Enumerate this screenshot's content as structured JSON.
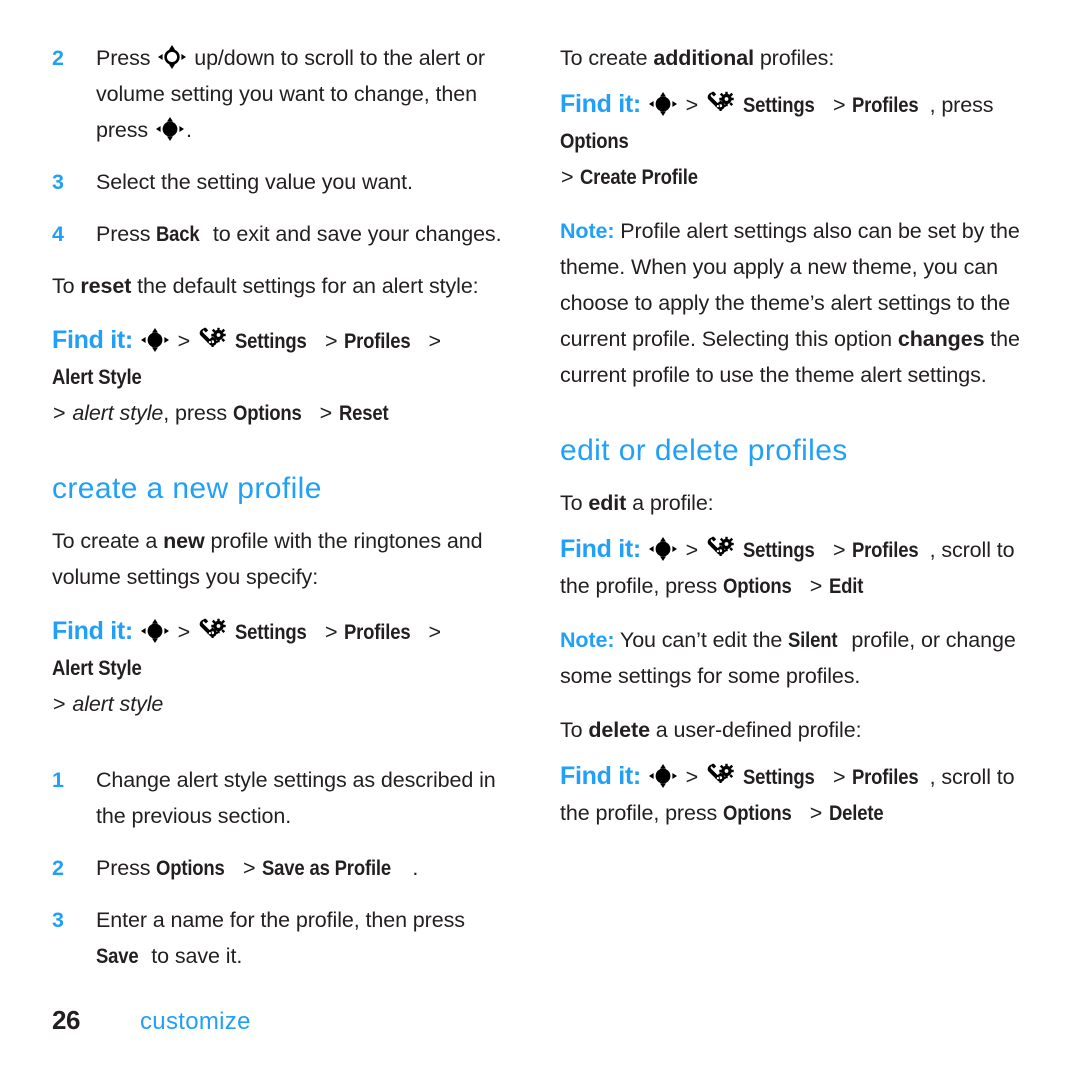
{
  "document": {
    "page_number": "26",
    "chapter": "customize",
    "accent_color": "#22a0f8",
    "text_color": "#231f20"
  },
  "icons": {
    "nav_scroll": "nav-key-hollow-icon",
    "nav_press": "nav-key-filled-icon",
    "settings": "settings-wrench-gear-icon"
  },
  "left_column": {
    "steps_top": [
      {
        "num": "2",
        "pre": "Press ",
        "mid": " up/down to scroll to the alert or volume setting you want to change, then press ",
        "post": "."
      },
      {
        "num": "3",
        "text": "Select the setting value you want."
      },
      {
        "num": "4",
        "pre": "Press ",
        "key": "Back",
        "post": " to exit and save your changes."
      }
    ],
    "reset_intro": {
      "pre": "To ",
      "bold": "reset",
      "post": " the default settings for an alert style:"
    },
    "reset_findit": {
      "label": "Find it:",
      "items": [
        "Settings",
        "Profiles",
        "Alert Style"
      ],
      "cont_italic": "alert style",
      "cont_mid": ", press ",
      "cont_item1": "Options",
      "cont_item2": "Reset"
    },
    "heading": "create a new profile",
    "create_intro": {
      "pre": "To create a ",
      "bold": "new",
      "post": " profile with the ringtones and volume settings you specify:"
    },
    "create_findit": {
      "label": "Find it:",
      "items": [
        "Settings",
        "Profiles",
        "Alert Style"
      ],
      "cont_italic": "alert style"
    },
    "steps_bottom": [
      {
        "num": "1",
        "text": "Change alert style settings as described in the previous section."
      },
      {
        "num": "2",
        "pre": "Press ",
        "item1": "Options",
        "item2": "Save as Profile",
        "post": "."
      },
      {
        "num": "3",
        "pre": "Enter a name for the profile, then press ",
        "item1": "Save",
        "post": " to save it."
      }
    ]
  },
  "right_column": {
    "additional_intro": {
      "pre": "To create ",
      "bold": "additional",
      "post": " profiles:"
    },
    "additional_findit": {
      "label": "Find it:",
      "items": [
        "Settings",
        "Profiles"
      ],
      "mid": ", press ",
      "item_options": "Options",
      "cont_item": "Create Profile"
    },
    "note_theme": {
      "label": "Note:",
      "text1": " Profile alert settings also can be set by the theme. When you apply a new theme, you can choose to apply the theme’s alert settings to the current profile. Selecting this option ",
      "bold": "changes",
      "text2": " the current profile to use the theme alert settings."
    },
    "heading": "edit or delete profiles",
    "edit_intro": {
      "pre": "To ",
      "bold": "edit",
      "post": " a profile:"
    },
    "edit_findit": {
      "label": "Find it:",
      "items": [
        "Settings",
        "Profiles"
      ],
      "mid": ", scroll to the profile, press ",
      "item_options": "Options",
      "item_action": "Edit"
    },
    "note_silent": {
      "label": "Note:",
      "text1": " You can’t edit the ",
      "bold": "Silent",
      "text2": " profile, or change some settings for some profiles."
    },
    "delete_intro": {
      "pre": "To ",
      "bold": "delete",
      "post": " a user-defined profile:"
    },
    "delete_findit": {
      "label": "Find it:",
      "items": [
        "Settings",
        "Profiles"
      ],
      "mid": ", scroll to the profile, press ",
      "item_options": "Options",
      "item_action": "Delete"
    }
  }
}
